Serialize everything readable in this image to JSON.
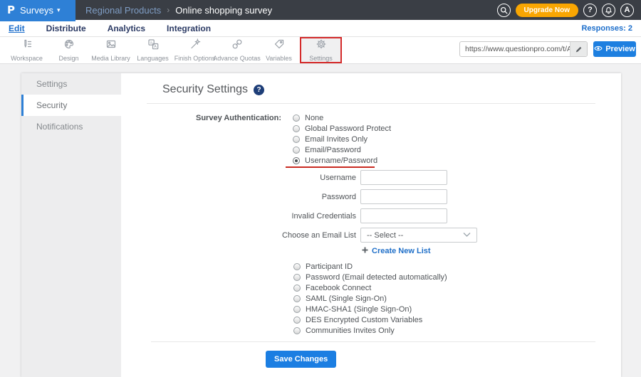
{
  "topbar": {
    "logo_letter": "P",
    "product_menu": "Surveys",
    "caret": "▾",
    "breadcrumb": {
      "folder": "Regional Products",
      "separator": "›",
      "survey": "Online shopping survey"
    },
    "upgrade_label": "Upgrade Now",
    "help_label": "?",
    "avatar_label": "A"
  },
  "nav": {
    "tabs": [
      {
        "label": "Edit",
        "active": true
      },
      {
        "label": "Distribute",
        "active": false
      },
      {
        "label": "Analytics",
        "active": false
      },
      {
        "label": "Integration",
        "active": false
      }
    ],
    "responses_label": "Responses: 2"
  },
  "toolbar": {
    "items": [
      {
        "label": "Workspace",
        "icon": "pencil-lines-icon"
      },
      {
        "label": "Design",
        "icon": "palette-icon"
      },
      {
        "label": "Media Library",
        "icon": "image-icon"
      },
      {
        "label": "Languages",
        "icon": "translate-icon"
      },
      {
        "label": "Finish Options",
        "icon": "magic-wand-icon"
      },
      {
        "label": "Advance Quotas",
        "icon": "chain-links-icon"
      },
      {
        "label": "Variables",
        "icon": "tag-icon"
      },
      {
        "label": "Settings",
        "icon": "gear-icon",
        "highlighted": true
      }
    ],
    "share_url": "https://www.questionpro.com/t/APNrfZ",
    "preview_label": "Preview"
  },
  "sidebar": {
    "items": [
      {
        "label": "Settings",
        "active": false
      },
      {
        "label": "Security",
        "active": true
      },
      {
        "label": "Notifications",
        "active": false
      }
    ]
  },
  "main": {
    "title": "Security Settings",
    "auth": {
      "label": "Survey Authentication:",
      "options": [
        "None",
        "Global Password Protect",
        "Email Invites Only",
        "Email/Password",
        "Username/Password"
      ],
      "selected": "Username/Password"
    },
    "fields": [
      {
        "label": "Username",
        "value": ""
      },
      {
        "label": "Password",
        "value": ""
      },
      {
        "label": "Invalid Credentials",
        "value": ""
      }
    ],
    "email_list": {
      "label": "Choose an Email List",
      "selected_value": "-- Select --"
    },
    "create_list_label": "Create New List",
    "more_options": [
      "Participant ID",
      "Password (Email detected automatically)",
      "Facebook Connect",
      "SAML (Single Sign-On)",
      "HMAC-SHA1 (Single Sign-On)",
      "DES Encrypted Custom Variables",
      "Communities Invites Only"
    ],
    "save_label": "Save Changes"
  },
  "colors": {
    "brand_blue": "#2e80d6",
    "link_blue": "#1f6fc8",
    "button_blue": "#1d7fe0",
    "upgrade_orange": "#f9a602",
    "annotation_red": "#d42a2a",
    "topbar_dark": "#3a3e45"
  }
}
